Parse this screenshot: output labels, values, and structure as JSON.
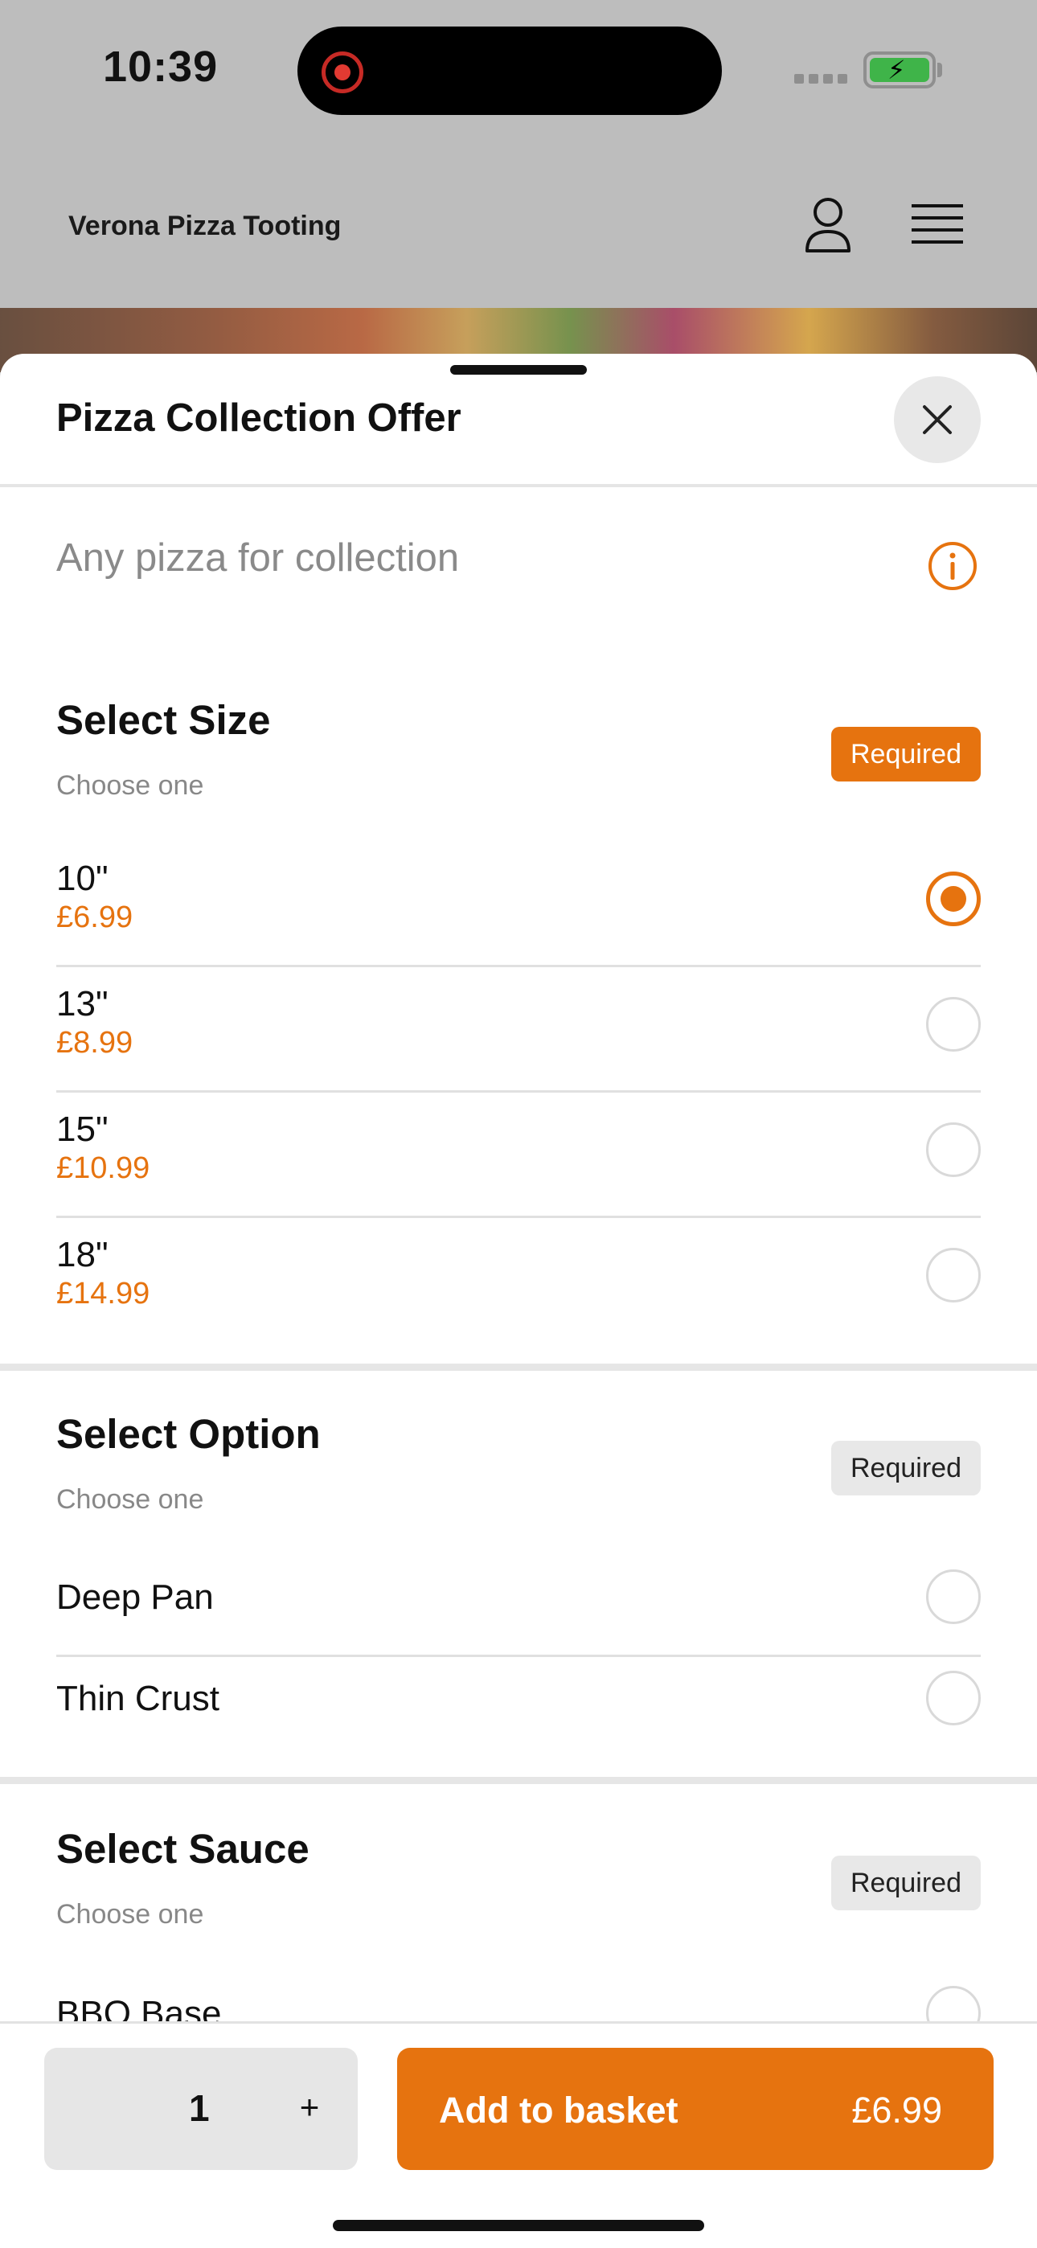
{
  "status_bar": {
    "time": "10:39"
  },
  "header": {
    "brand": "Verona Pizza Tooting"
  },
  "sheet": {
    "title": "Pizza Collection Offer",
    "description": "Any pizza for collection"
  },
  "sections": [
    {
      "title": "Select Size",
      "subtitle": "Choose one",
      "badge": "Required",
      "options": [
        {
          "name": "10\"",
          "price": "£6.99",
          "selected": true
        },
        {
          "name": "13\"",
          "price": "£8.99",
          "selected": false
        },
        {
          "name": "15\"",
          "price": "£10.99",
          "selected": false
        },
        {
          "name": "18\"",
          "price": "£14.99",
          "selected": false
        }
      ]
    },
    {
      "title": "Select Option",
      "subtitle": "Choose one",
      "badge": "Required",
      "options": [
        {
          "name": "Deep Pan",
          "selected": false
        },
        {
          "name": "Thin Crust",
          "selected": false
        }
      ]
    },
    {
      "title": "Select Sauce",
      "subtitle": "Choose one",
      "badge": "Required",
      "options": [
        {
          "name": "BBQ Base",
          "selected": false
        }
      ]
    }
  ],
  "bottom_bar": {
    "quantity": "1",
    "plus": "+",
    "add_label": "Add to basket",
    "add_price": "£6.99"
  },
  "colors": {
    "accent": "#e6730f"
  },
  "icons": [
    "record-icon",
    "signal-icon",
    "battery-icon",
    "user-icon",
    "menu-icon",
    "close-icon",
    "info-icon"
  ]
}
